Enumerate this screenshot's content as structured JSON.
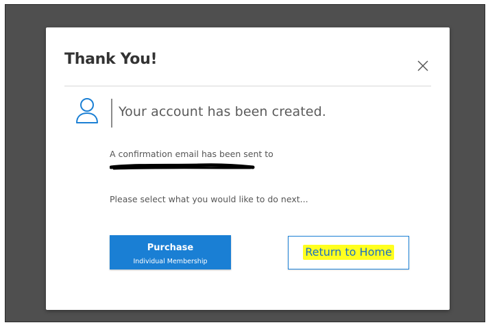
{
  "modal": {
    "title": "Thank You!",
    "headline": "Your account has been created.",
    "confirmation_text": "A confirmation email has been sent to",
    "next_text": "Please select what you would like to do next..."
  },
  "buttons": {
    "purchase": {
      "label": "Purchase",
      "sublabel": "Individual Membership",
      "color": "#1a7fd4"
    },
    "return_home": {
      "label": "Return to Home",
      "highlight_color": "#ffff1f"
    }
  },
  "icons": {
    "close": "close-icon",
    "user": "user-icon"
  },
  "colors": {
    "backdrop": "#4f4f4f",
    "accent": "#1a7fd4",
    "text": "#555555"
  }
}
